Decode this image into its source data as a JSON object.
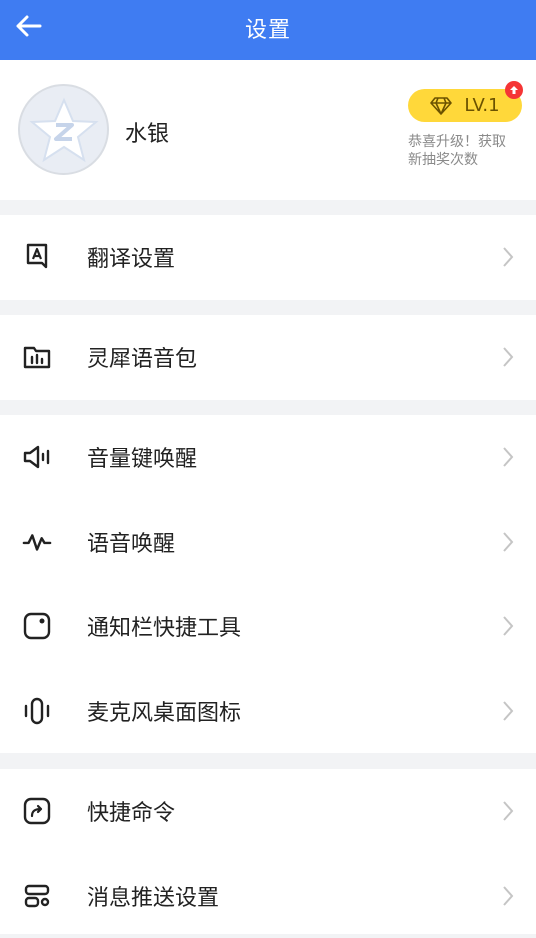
{
  "header": {
    "title": "设置"
  },
  "profile": {
    "username": "水银",
    "level": "LV.1",
    "level_tip_line1": "恭喜升级！获取",
    "level_tip_line2": "新抽奖次数"
  },
  "groups": [
    {
      "items": [
        {
          "label": "翻译设置",
          "icon": "translate-icon"
        }
      ]
    },
    {
      "items": [
        {
          "label": "灵犀语音包",
          "icon": "voice-pack-icon"
        }
      ]
    },
    {
      "items": [
        {
          "label": "音量键唤醒",
          "icon": "volume-key-icon"
        },
        {
          "label": "语音唤醒",
          "icon": "voice-wave-icon"
        },
        {
          "label": "通知栏快捷工具",
          "icon": "notification-tool-icon"
        },
        {
          "label": "麦克风桌面图标",
          "icon": "microphone-icon"
        }
      ]
    },
    {
      "items": [
        {
          "label": "快捷命令",
          "icon": "shortcut-icon"
        },
        {
          "label": "消息推送设置",
          "icon": "push-settings-icon"
        }
      ]
    }
  ],
  "colors": {
    "header": "#3f7cf2",
    "badge": "#ffd83a",
    "badge_dot": "#f53535",
    "background": "#f2f3f5"
  }
}
